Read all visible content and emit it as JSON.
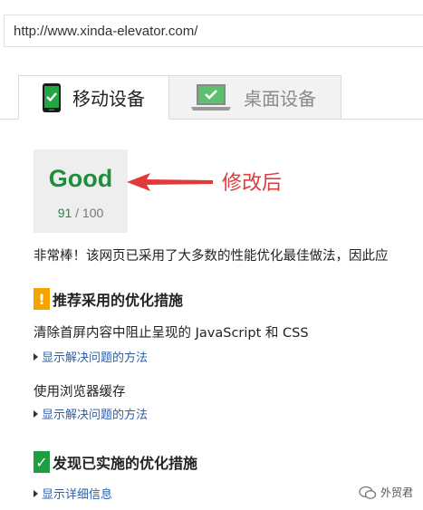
{
  "address_bar": {
    "url": "http://www.xinda-elevator.com/"
  },
  "tabs": [
    {
      "label": "移动设备",
      "icon": "smartphone-icon",
      "selected": true
    },
    {
      "label": "桌面设备",
      "icon": "laptop-icon",
      "selected": false
    }
  ],
  "score": {
    "rating": "Good",
    "value": "91",
    "max": "/ 100",
    "color": "#1e8e3e"
  },
  "annotation": {
    "text": "修改后",
    "color": "#e2393a"
  },
  "summary": "非常棒！该网页已采用了大多数的性能优化最佳做法，因此应",
  "sections": {
    "recommended": {
      "title": "推荐采用的优化措施",
      "badge": "!",
      "items": [
        {
          "text": "清除首屏内容中阻止呈现的 JavaScript 和 CSS",
          "link": "显示解决问题的方法"
        },
        {
          "text": "使用浏览器缓存",
          "link": "显示解决问题的方法"
        }
      ]
    },
    "implemented": {
      "title": "发现已实施的优化措施",
      "badge": "✓",
      "link": "显示详细信息"
    }
  },
  "watermark": {
    "text": "外贸君"
  }
}
